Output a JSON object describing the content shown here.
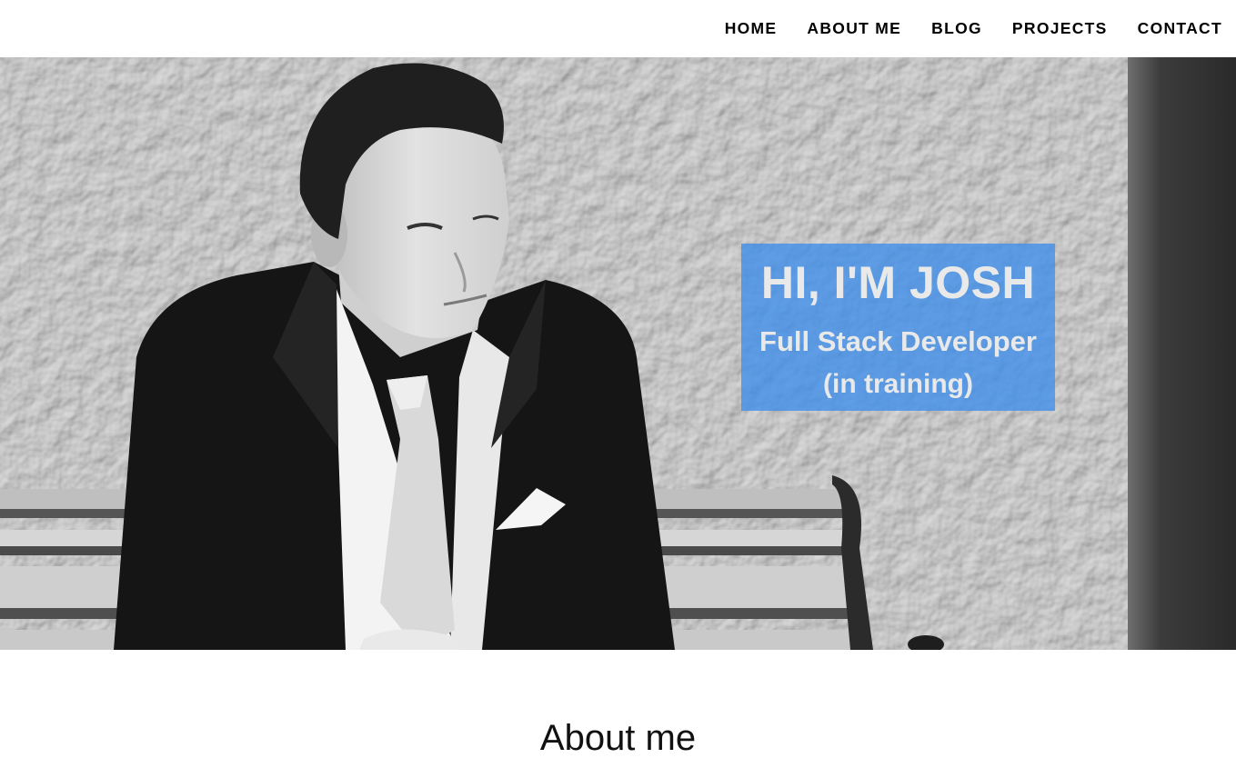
{
  "nav": {
    "items": [
      {
        "label": "HOME"
      },
      {
        "label": "ABOUT ME"
      },
      {
        "label": "BLOG"
      },
      {
        "label": "PROJECTS"
      },
      {
        "label": "CONTACT"
      }
    ]
  },
  "hero": {
    "title": "HI, I'M JOSH",
    "subtitle": "Full Stack Developer",
    "subtitle_note": "(in training)",
    "overlay_color": "#3e8eeb",
    "photo_style": "black-and-white"
  },
  "about": {
    "heading": "About me"
  }
}
